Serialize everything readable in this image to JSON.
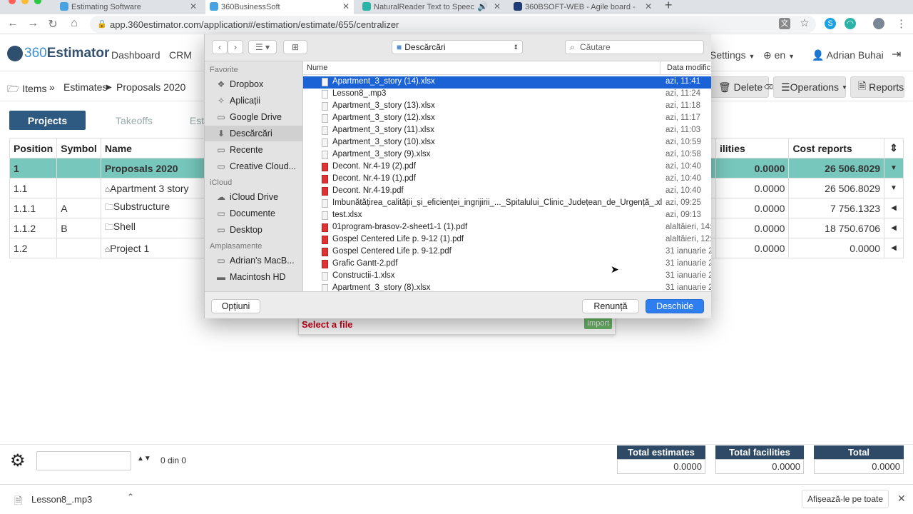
{
  "browser": {
    "tabs": [
      {
        "title": "Estimating Software",
        "icon_color": "#4aa3df"
      },
      {
        "title": "360BusinessSoft",
        "icon_color": "#4aa3df"
      },
      {
        "title": "NaturalReader Text to Speec",
        "icon_color": "#2ab3a6"
      },
      {
        "title": "360BSOFT-WEB - Agile board -",
        "icon_color": "#1f3b73"
      }
    ],
    "new_tab": "+",
    "url": "app.360estimator.com/application#/estimation/estimate/655/centralizer"
  },
  "app": {
    "logo_number": "360",
    "logo_word": "Estimator",
    "menu": [
      "Dashboard",
      "CRM"
    ],
    "right_menu": {
      "settings": "Settings",
      "language": "en",
      "user": "Adrian Buhai"
    }
  },
  "toolbar": {
    "breadcrumb": {
      "items": "Items",
      "estimates": "Estimates",
      "current": "Proposals 2020"
    },
    "delete": "Delete",
    "operations": "Operations",
    "reports": "Reports"
  },
  "tabs": {
    "projects": "Projects",
    "takeoffs": "Takeoffs",
    "est": "Est"
  },
  "grid": {
    "headers": {
      "position": "Position",
      "symbol": "Symbol",
      "name": "Name",
      "facilities": "ilities",
      "cost": "Cost reports"
    },
    "rows": [
      {
        "position": "1",
        "symbol": "",
        "name": "Proposals 2020",
        "facilities": "0.0000",
        "cost": "26 506.8029",
        "icon": "",
        "toggle": "down",
        "selected": true
      },
      {
        "position": "1.1",
        "symbol": "",
        "name": "Apartment 3 story",
        "facilities": "0.0000",
        "cost": "26 506.8029",
        "icon": "house",
        "toggle": "down",
        "selected": false
      },
      {
        "position": "1.1.1",
        "symbol": "A",
        "name": "Substructure",
        "facilities": "0.0000",
        "cost": "7 756.1323",
        "icon": "folder",
        "toggle": "left",
        "selected": false
      },
      {
        "position": "1.1.2",
        "symbol": "B",
        "name": "Shell",
        "facilities": "0.0000",
        "cost": "18 750.6706",
        "icon": "folder",
        "toggle": "left",
        "selected": false
      },
      {
        "position": "1.2",
        "symbol": "",
        "name": "Project 1",
        "facilities": "0.0000",
        "cost": "0.0000",
        "icon": "house",
        "toggle": "left",
        "selected": false
      }
    ]
  },
  "footer": {
    "pager": "0 din 0",
    "totals": [
      {
        "label": "Total estimates",
        "value": "0.0000"
      },
      {
        "label": "Total facilities",
        "value": "0.0000"
      },
      {
        "label": "Total",
        "value": "0.0000"
      }
    ]
  },
  "import_panel": {
    "select_label": "Select a file",
    "import_button": "Import"
  },
  "dialog": {
    "location": "Descărcări",
    "search_placeholder": "Căutare",
    "favorites_header": "Favorite",
    "favorites": [
      {
        "label": "Dropbox",
        "icon": "dropbox-icon"
      },
      {
        "label": "Aplicații",
        "icon": "applications-icon"
      },
      {
        "label": "Google Drive",
        "icon": "folder-icon"
      },
      {
        "label": "Descărcări",
        "icon": "downloads-icon",
        "selected": true
      },
      {
        "label": "Recente",
        "icon": "folder-icon"
      },
      {
        "label": "Creative Cloud...",
        "icon": "folder-icon"
      }
    ],
    "icloud_header": "iCloud",
    "icloud": [
      {
        "label": "iCloud Drive",
        "icon": "cloud-icon"
      },
      {
        "label": "Documente",
        "icon": "folder-icon"
      },
      {
        "label": "Desktop",
        "icon": "folder-icon"
      }
    ],
    "locations_header": "Amplasamente",
    "locations": [
      {
        "label": "Adrian's MacB...",
        "icon": "laptop-icon"
      },
      {
        "label": "Macintosh HD",
        "icon": "disk-icon"
      }
    ],
    "col_name": "Nume",
    "col_date": "Data modific",
    "files": [
      {
        "name": "Apartment_3_story (14).xlsx",
        "date": "azi, 11:41",
        "type": "xls",
        "selected": true
      },
      {
        "name": "Lesson8_.mp3",
        "date": "azi, 11:24",
        "type": "mp3"
      },
      {
        "name": "Apartment_3_story (13).xlsx",
        "date": "azi, 11:18",
        "type": "xls"
      },
      {
        "name": "Apartment_3_story (12).xlsx",
        "date": "azi, 11:17",
        "type": "xls"
      },
      {
        "name": "Apartment_3_story (11).xlsx",
        "date": "azi, 11:03",
        "type": "xls"
      },
      {
        "name": "Apartment_3_story (10).xlsx",
        "date": "azi, 10:59",
        "type": "xls"
      },
      {
        "name": "Apartment_3_story (9).xlsx",
        "date": "azi, 10:58",
        "type": "xls"
      },
      {
        "name": "Decont. Nr.4-19 (2).pdf",
        "date": "azi, 10:40",
        "type": "pdf"
      },
      {
        "name": "Decont. Nr.4-19 (1).pdf",
        "date": "azi, 10:40",
        "type": "pdf"
      },
      {
        "name": "Decont. Nr.4-19.pdf",
        "date": "azi, 10:40",
        "type": "pdf"
      },
      {
        "name": "Imbunătățirea_calității_și_eficienței_ingrijirii_..._Spitalului_Clinic_Județean_de_Urgență_.xlsx",
        "date": "azi, 09:25",
        "type": "xls"
      },
      {
        "name": "test.xlsx",
        "date": "azi, 09:13",
        "type": "xls"
      },
      {
        "name": "01program-brasov-2-sheet1-1 (1).pdf",
        "date": "alaltăieri, 14:",
        "type": "pdf"
      },
      {
        "name": "Gospel Centered Life p. 9-12 (1).pdf",
        "date": "alaltăieri, 12:",
        "type": "pdf"
      },
      {
        "name": "Gospel Centered Life p. 9-12.pdf",
        "date": "31 ianuarie 2",
        "type": "pdf"
      },
      {
        "name": "Grafic Gantt-2.pdf",
        "date": "31 ianuarie 2",
        "type": "pdf"
      },
      {
        "name": "Constructii-1.xlsx",
        "date": "31 ianuarie 2",
        "type": "xls"
      },
      {
        "name": "Apartment_3_story (8).xlsx",
        "date": "31 ianuarie 2",
        "type": "xls"
      }
    ],
    "options_button": "Opțiuni",
    "cancel_button": "Renunță",
    "open_button": "Deschide"
  },
  "downloads": {
    "file": "Lesson8_.mp3",
    "show_all": "Afișează-le pe toate"
  }
}
